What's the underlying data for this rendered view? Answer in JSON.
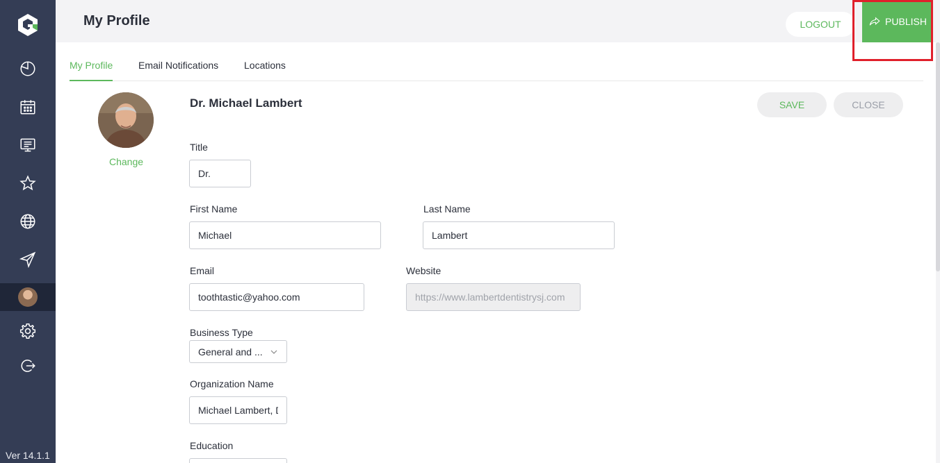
{
  "app": {
    "version": "Ver 14.1.1"
  },
  "header": {
    "title": "My Profile",
    "logout_label": "LOGOUT",
    "publish_label": "PUBLISH"
  },
  "tabs": [
    {
      "label": "My Profile",
      "active": true
    },
    {
      "label": "Email Notifications",
      "active": false
    },
    {
      "label": "Locations",
      "active": false
    }
  ],
  "profile": {
    "change_label": "Change",
    "full_name": "Dr. Michael Lambert",
    "save_label": "SAVE",
    "close_label": "CLOSE"
  },
  "form": {
    "title_label": "Title",
    "title_value": "Dr.",
    "first_name_label": "First Name",
    "first_name_value": "Michael",
    "last_name_label": "Last Name",
    "last_name_value": "Lambert",
    "email_label": "Email",
    "email_value": "toothtastic@yahoo.com",
    "website_label": "Website",
    "website_value": "https://www.lambertdentistrysj.com",
    "business_type_label": "Business Type",
    "business_type_value": "General and ...",
    "org_name_label": "Organization Name",
    "org_name_value": "Michael Lambert, DDS",
    "education_label": "Education"
  },
  "colors": {
    "accent": "#5cb85c",
    "sidebar": "#343d55",
    "highlight": "#e0202b"
  },
  "icons": [
    "dashboard-icon",
    "calendar-icon",
    "monitor-icon",
    "star-icon",
    "globe-icon",
    "send-icon",
    "user-avatar",
    "gear-icon",
    "logout-icon"
  ]
}
